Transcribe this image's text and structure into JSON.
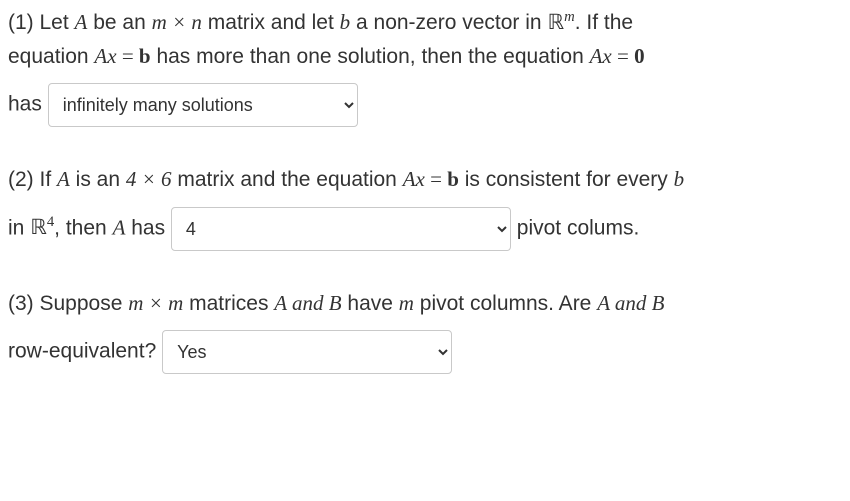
{
  "q1": {
    "line1_a": "(1) Let ",
    "line1_A": "A",
    "line1_b": " be an ",
    "line1_mxn": "m × n",
    "line1_c": " matrix and let ",
    "line1_bvec": "b",
    "line1_d": " a non-zero vector in ",
    "line1_Rm_R": "ℝ",
    "line1_Rm_m": "m",
    "line1_e": ". If the",
    "line2_a": "equation ",
    "line2_Ax": "Ax",
    "line2_eq": " = ",
    "line2_b": "b",
    "line2_c": " has more than one solution, then the equation ",
    "line2_Ax2": "Ax",
    "line2_eq2": " = ",
    "line2_zero": "0",
    "line3_has": "has ",
    "select_value": "infinitely many solutions"
  },
  "q2": {
    "line1_a": "(2) If ",
    "line1_A": "A",
    "line1_b": " is an ",
    "line1_dim": "4 × 6",
    "line1_c": " matrix and the equation ",
    "line1_Ax": "Ax",
    "line1_eq": " = ",
    "line1_bvec": "b",
    "line1_d": " is consistent for every ",
    "line1_bvec2": "b",
    "line2_a": "in ",
    "line2_R": "ℝ",
    "line2_exp": "4",
    "line2_b": ", then ",
    "line2_A": "A",
    "line2_c": " has ",
    "select_value": "4",
    "line2_d": " pivot colums."
  },
  "q3": {
    "line1_a": "(3) Suppose ",
    "line1_mxm": "m × m",
    "line1_b": " matrices ",
    "line1_A": "A",
    "line1_and": " and ",
    "line1_B": "B",
    "line1_c": "  have ",
    "line1_m": "m",
    "line1_d": " pivot columns. Are ",
    "line1_A2": "A",
    "line1_and2": " and ",
    "line1_B2": "B",
    "line2_a": "row-equivalent? ",
    "select_value": "Yes"
  }
}
